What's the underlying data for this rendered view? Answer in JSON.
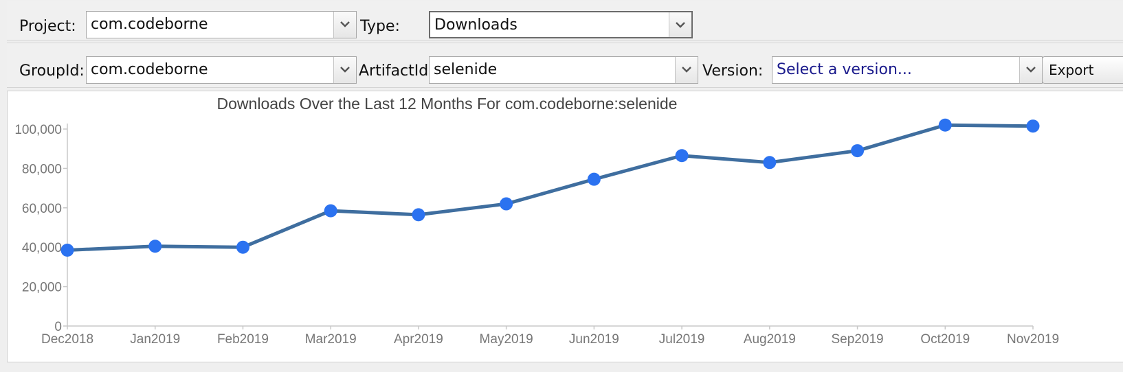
{
  "row1": {
    "project": {
      "label": "Project:",
      "value": "com.codeborne"
    },
    "type": {
      "label": "Type:",
      "value": "Downloads"
    }
  },
  "row2": {
    "groupid": {
      "label": "GroupId:",
      "value": "com.codeborne"
    },
    "artifactid": {
      "label": "ArtifactId:",
      "value": "selenide"
    },
    "version": {
      "label": "Version:",
      "placeholder": "Select a version..."
    },
    "export_label": "Export"
  },
  "chart_data": {
    "type": "line",
    "title": "Downloads Over the Last 12 Months For com.codeborne:selenide",
    "xlabel": "",
    "ylabel": "",
    "categories": [
      "Dec2018",
      "Jan2019",
      "Feb2019",
      "Mar2019",
      "Apr2019",
      "May2019",
      "Jun2019",
      "Jul2019",
      "Aug2019",
      "Sep2019",
      "Oct2019",
      "Nov2019"
    ],
    "series": [
      {
        "values": [
          38500,
          40500,
          40000,
          58500,
          56500,
          62000,
          74500,
          86500,
          83000,
          89000,
          102000,
          101500
        ]
      }
    ],
    "ylim": [
      0,
      100000
    ],
    "yticks": [
      0,
      20000,
      40000,
      60000,
      80000,
      100000
    ],
    "ytick_labels": [
      "0",
      "20,000",
      "40,000",
      "60,000",
      "80,000",
      "100,000"
    ],
    "grid": false,
    "legend": "none",
    "line_color": "#3f6e9f",
    "marker_color": "#2b72f0",
    "axis_color": "#c8c8c8",
    "text_color": "#777777"
  }
}
